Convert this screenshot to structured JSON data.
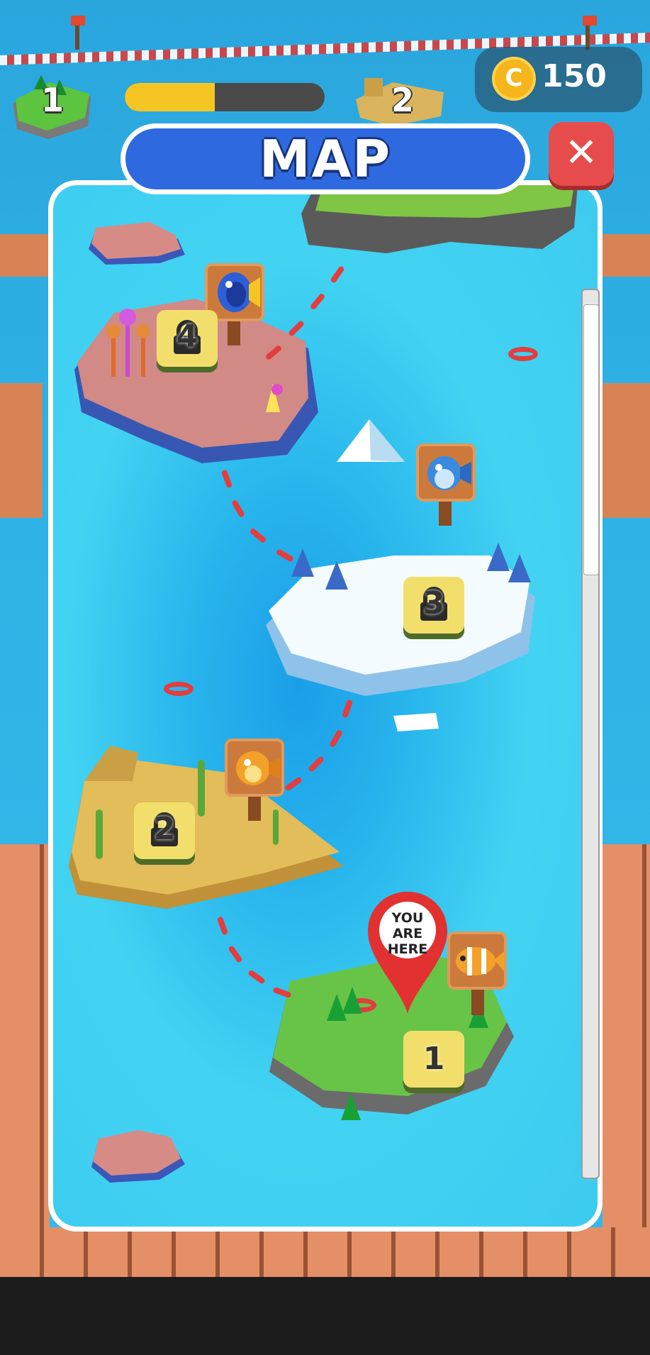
{
  "hud": {
    "level_current": "1",
    "level_next": "2",
    "progress": 0.45,
    "coins": "150",
    "coin_symbol": "C"
  },
  "map": {
    "title": "MAP",
    "close_symbol": "✕",
    "marker_line1": "YOU ARE",
    "marker_line2": "HERE",
    "islands": [
      {
        "level": "1",
        "locked": false,
        "fish": "clownfish"
      },
      {
        "level": "2",
        "locked": true,
        "fish": "pufferfish-orange"
      },
      {
        "level": "3",
        "locked": true,
        "fish": "pufferfish-blue"
      },
      {
        "level": "4",
        "locked": true,
        "fish": "blue-tang"
      }
    ]
  },
  "colors": {
    "title_blue": "#2f69e0",
    "close_red": "#e74c4c",
    "progress_yellow": "#f5c623",
    "coin_gold": "#f6b51b"
  }
}
